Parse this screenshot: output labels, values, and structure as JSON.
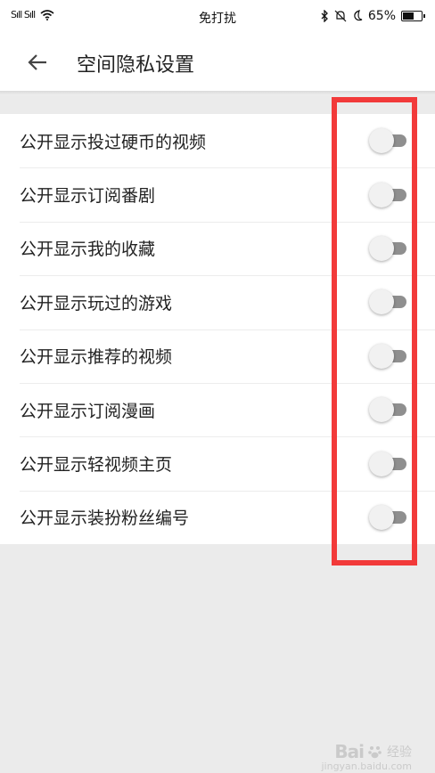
{
  "status_bar": {
    "left_signal": "SıIl SıIl",
    "center_text": "免打扰",
    "right_icons": [
      "bluetooth-icon",
      "bell-off-icon",
      "moon-icon"
    ],
    "battery_text": "65%",
    "battery_level": 0.65
  },
  "header": {
    "title": "空间隐私设置"
  },
  "settings": [
    {
      "label": "公开显示投过硬币的视频",
      "enabled": false
    },
    {
      "label": "公开显示订阅番剧",
      "enabled": false
    },
    {
      "label": "公开显示我的收藏",
      "enabled": false
    },
    {
      "label": "公开显示玩过的游戏",
      "enabled": false
    },
    {
      "label": "公开显示推荐的视频",
      "enabled": false
    },
    {
      "label": "公开显示订阅漫画",
      "enabled": false
    },
    {
      "label": "公开显示轻视频主页",
      "enabled": false
    },
    {
      "label": "公开显示装扮粉丝编号",
      "enabled": false
    }
  ],
  "watermark": {
    "logo": "Bai",
    "suffix": "经验",
    "site": "jingyan.baidu.com"
  },
  "colors": {
    "highlight": "#f23a3a",
    "toggle_track": "#8f8f8f",
    "background": "#ebebeb"
  }
}
